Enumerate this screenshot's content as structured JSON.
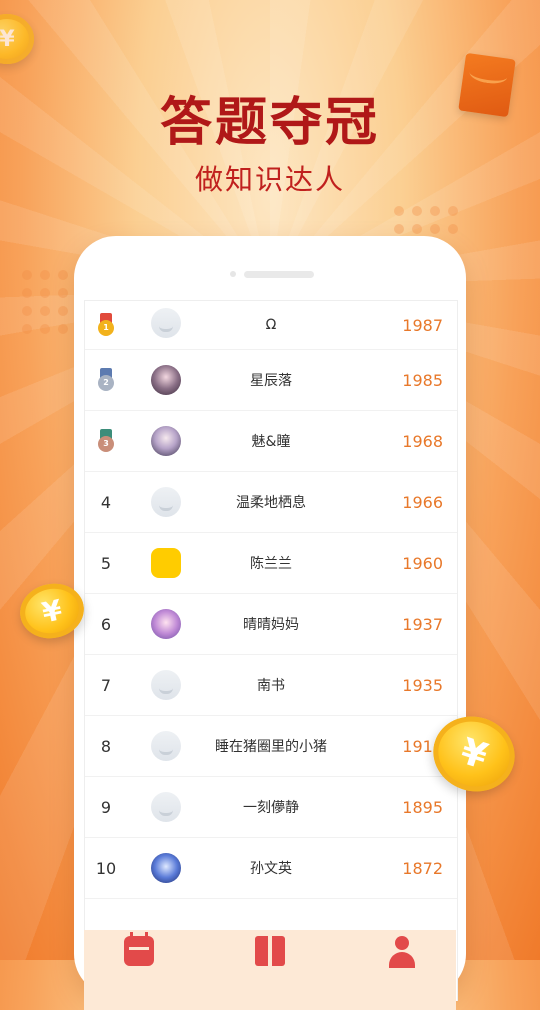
{
  "header": {
    "title": "答题夺冠",
    "subtitle": "做知识达人"
  },
  "coins": {
    "symbol": "¥"
  },
  "leaderboard": [
    {
      "rank": "1",
      "medal": "gold-medal-icon",
      "avatar": "default-avatar",
      "name": "Ω",
      "score": "1987"
    },
    {
      "rank": "2",
      "medal": "silver-medal-icon",
      "avatar": "anime-avatar",
      "name": "星辰落",
      "score": "1985"
    },
    {
      "rank": "3",
      "medal": "bronze-medal-icon",
      "avatar": "anime-avatar",
      "name": "魅&瞳",
      "score": "1968"
    },
    {
      "rank": "4",
      "avatar": "default-avatar",
      "name": "温柔地栖息",
      "score": "1966"
    },
    {
      "rank": "5",
      "avatar": "duck-avatar",
      "name": "陈兰兰",
      "score": "1960"
    },
    {
      "rank": "6",
      "avatar": "anime-avatar",
      "name": "晴晴妈妈",
      "score": "1937"
    },
    {
      "rank": "7",
      "avatar": "default-avatar",
      "name": "南书",
      "score": "1935"
    },
    {
      "rank": "8",
      "avatar": "default-avatar",
      "name": "睡在猪圈里的小猪",
      "score": "1916"
    },
    {
      "rank": "9",
      "avatar": "default-avatar",
      "name": "一刻儚静",
      "score": "1895"
    },
    {
      "rank": "10",
      "avatar": "anime-avatar",
      "name": "孙文英",
      "score": "1872"
    }
  ],
  "bottom_nav": [
    {
      "icon": "calendar-icon"
    },
    {
      "icon": "gift-icon"
    },
    {
      "icon": "user-icon"
    }
  ],
  "colors": {
    "title": "#b01818",
    "score": "#e8782a",
    "background_orange": "#f07a2a"
  }
}
